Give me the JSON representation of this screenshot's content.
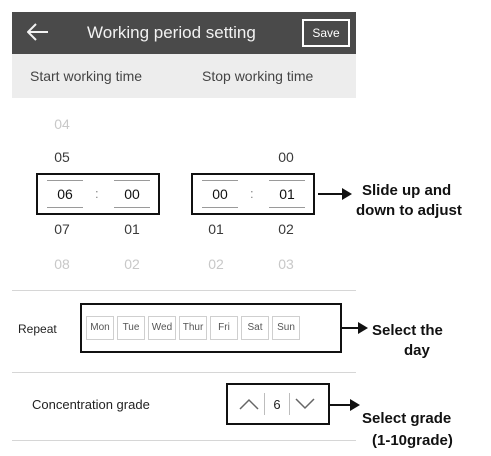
{
  "header": {
    "title": "Working period setting",
    "save_label": "Save"
  },
  "columns": {
    "start_label": "Start working time",
    "stop_label": "Stop working time"
  },
  "start_picker": {
    "hours": {
      "above2": "04",
      "above1": "05",
      "selected": "06",
      "below1": "07",
      "below2": "08"
    },
    "minutes": {
      "selected": "00",
      "below1": "01",
      "below2": "02"
    }
  },
  "stop_picker": {
    "hours": {
      "selected": "00",
      "below1": "01",
      "below2": "02"
    },
    "minutes": {
      "above1": "00",
      "selected": "01",
      "below1": "02",
      "below2": "03"
    }
  },
  "separator": ":",
  "annotations": {
    "slide": [
      "Slide up and",
      "down to adjust"
    ],
    "day": [
      "Select the",
      "day"
    ],
    "grade": [
      "Select grade",
      "(1-10grade)"
    ]
  },
  "repeat": {
    "label": "Repeat",
    "days": [
      "Mon",
      "Tue",
      "Wed",
      "Thur",
      "Fri",
      "Sat",
      "Sun"
    ]
  },
  "grade": {
    "label": "Concentration grade",
    "value": "6"
  }
}
